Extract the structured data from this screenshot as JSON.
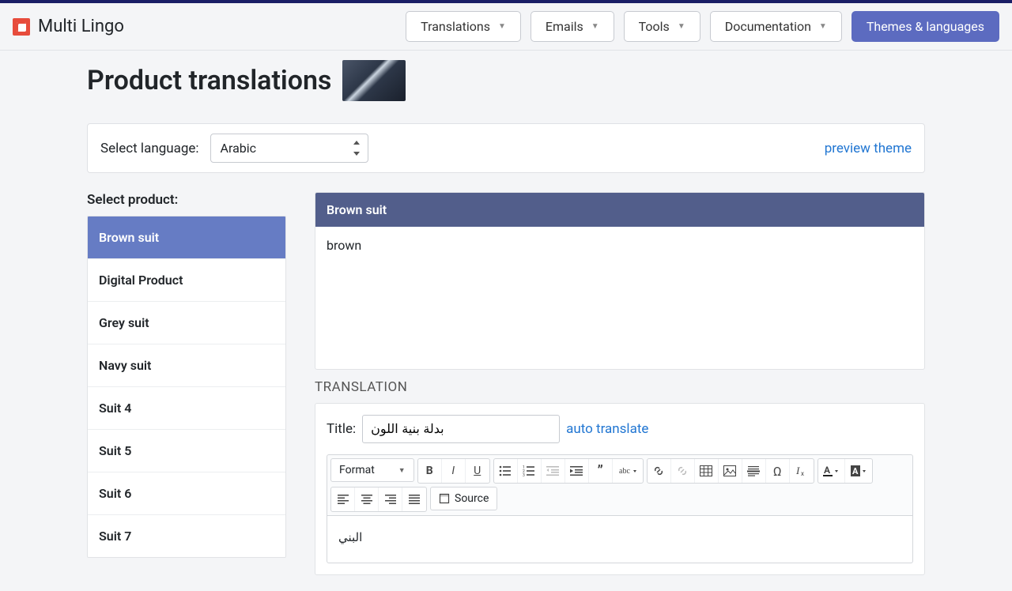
{
  "brand": {
    "name": "Multi Lingo"
  },
  "nav": {
    "translations": "Translations",
    "emails": "Emails",
    "tools": "Tools",
    "documentation": "Documentation",
    "themes": "Themes & languages"
  },
  "page": {
    "title": "Product translations",
    "select_language_label": "Select language:",
    "selected_language": "Arabic",
    "preview_theme": "preview theme",
    "select_product_label": "Select product:"
  },
  "products": [
    {
      "name": "Brown suit",
      "active": true
    },
    {
      "name": "Digital Product",
      "active": false
    },
    {
      "name": "Grey suit",
      "active": false
    },
    {
      "name": "Navy suit",
      "active": false
    },
    {
      "name": "Suit 4",
      "active": false
    },
    {
      "name": "Suit 5",
      "active": false
    },
    {
      "name": "Suit 6",
      "active": false
    },
    {
      "name": "Suit 7",
      "active": false
    }
  ],
  "source": {
    "title": "Brown suit",
    "body": "brown"
  },
  "translation": {
    "section_label": "TRANSLATION",
    "title_label": "Title:",
    "title_value": "بدلة بنية اللون",
    "auto_translate": "auto translate",
    "body": "البني"
  },
  "editor": {
    "format_label": "Format",
    "source_label": "Source"
  }
}
